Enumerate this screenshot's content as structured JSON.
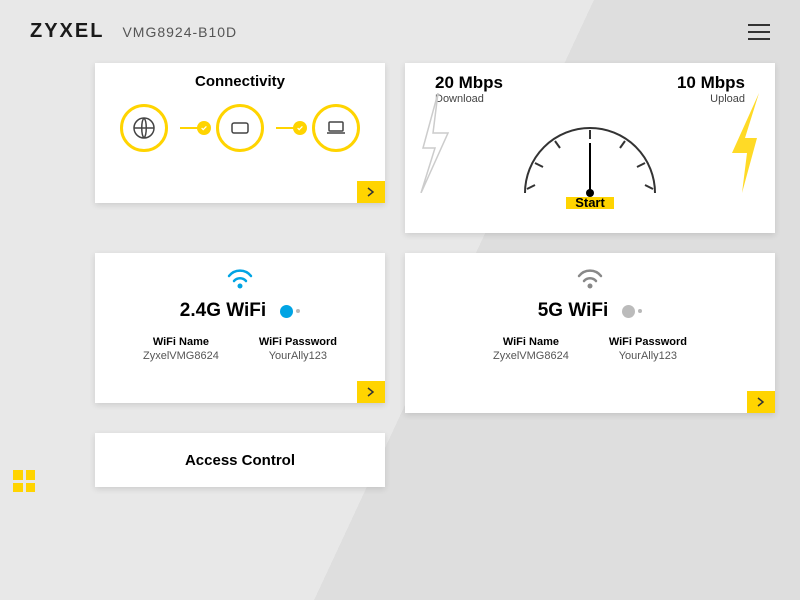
{
  "header": {
    "brand": "ZYXEL",
    "model": "VMG8924-B10D"
  },
  "connectivity": {
    "title": "Connectivity"
  },
  "speed": {
    "download_value": "20 Mbps",
    "download_label": "Download",
    "upload_value": "10 Mbps",
    "upload_label": "Upload",
    "start_label": "Start"
  },
  "wifi24": {
    "title": "2.4G WiFi",
    "name_label": "WiFi Name",
    "name_value": "ZyxelVMG8624",
    "pwd_label": "WiFi Password",
    "pwd_value": "YourAlly123",
    "enabled": true,
    "icon_color": "#00a4e4"
  },
  "wifi5": {
    "title": "5G WiFi",
    "name_label": "WiFi Name",
    "name_value": "ZyxelVMG8624",
    "pwd_label": "WiFi Password",
    "pwd_value": "YourAlly123",
    "enabled": false,
    "icon_color": "#888"
  },
  "access": {
    "title": "Access Control"
  },
  "colors": {
    "accent": "#ffd400",
    "active_blue": "#00a4e4"
  }
}
